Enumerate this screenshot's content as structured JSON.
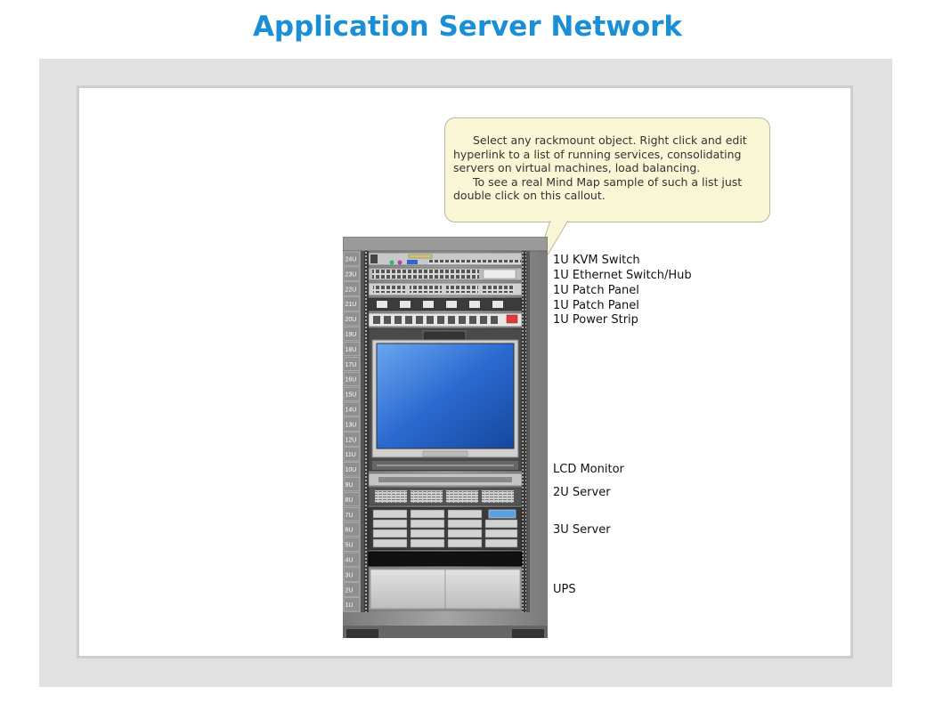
{
  "title": "Application Server Network",
  "callout": {
    "line1": "Select any rackmount object. Right click and edit",
    "line2": "hyperlink to a list of running services, consolidating",
    "line3": "servers on virtual machines, load balancing.",
    "line4": "To see a real Mind Map sample of such a list just",
    "line5": "double click on this callout."
  },
  "rack": {
    "units": [
      "24U",
      "23U",
      "22U",
      "21U",
      "20U",
      "19U",
      "18U",
      "17U",
      "16U",
      "15U",
      "14U",
      "13U",
      "12U",
      "11U",
      "10U",
      "9U",
      "8U",
      "7U",
      "6U",
      "5U",
      "4U",
      "3U",
      "2U",
      "1U"
    ]
  },
  "labels": {
    "kvm": "1U KVM Switch",
    "ethernet": "1U Ethernet Switch/Hub",
    "patch1": "1U Patch Panel",
    "patch2": "1U Patch Panel",
    "power": "1U Power Strip",
    "lcd": "LCD Monitor",
    "server2u": "2U Server",
    "server3u": "3U Server",
    "ups": "UPS"
  },
  "colors": {
    "title": "#1a8fd6",
    "callout_fill": "#f9f6d6",
    "rack_frame": "#8a8a8a",
    "screen": "#1f5fc0"
  }
}
